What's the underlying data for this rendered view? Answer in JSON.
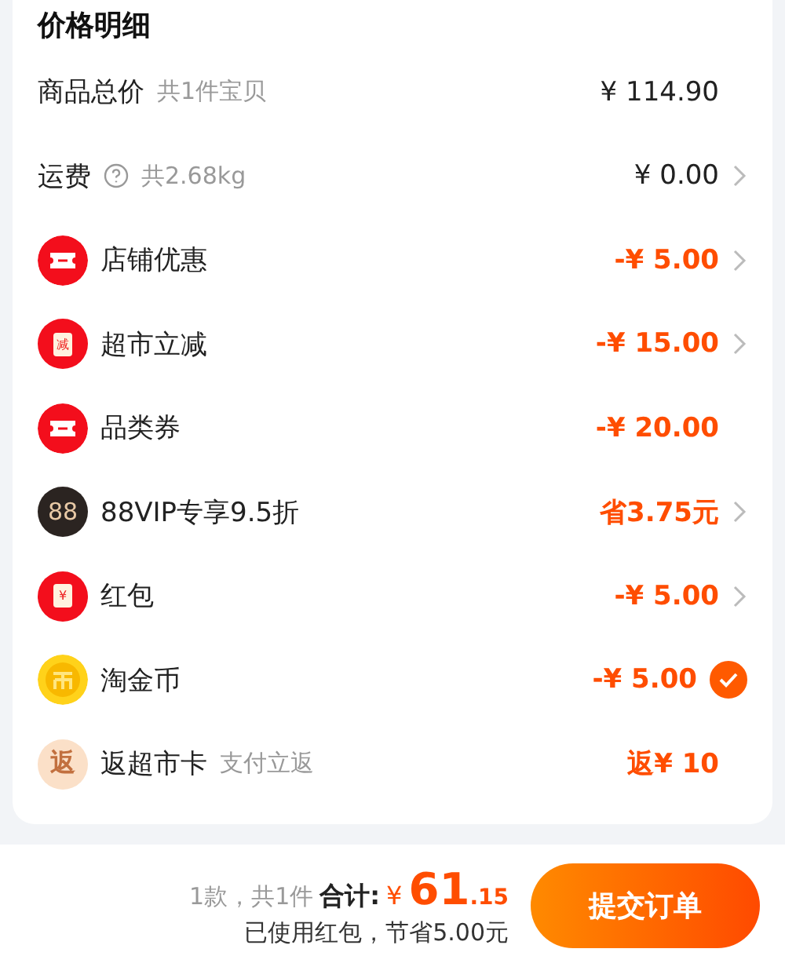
{
  "title": "价格明细",
  "rows": [
    {
      "kind": "plain",
      "label": "商品总价",
      "note": "共1件宝贝",
      "value": "¥ 114.90",
      "discount": false,
      "chevron": false
    },
    {
      "kind": "plain",
      "help": true,
      "label": "运费",
      "note": "共2.68kg",
      "value": "¥ 0.00",
      "discount": false,
      "chevron": true
    },
    {
      "kind": "ticket",
      "label": "店铺优惠",
      "value": "-¥ 5.00",
      "discount": true,
      "chevron": true
    },
    {
      "kind": "reduce",
      "badge": "减",
      "label": "超市立减",
      "value": "-¥ 15.00",
      "discount": true,
      "chevron": true
    },
    {
      "kind": "ticket",
      "label": "品类券",
      "value": "-¥ 20.00",
      "discount": true,
      "chevron": false
    },
    {
      "kind": "vip",
      "badge": "88",
      "label": "88VIP专享9.5折",
      "value": "省3.75元",
      "discount": true,
      "chevron": true
    },
    {
      "kind": "packet",
      "badge": "¥",
      "label": "红包",
      "value": "-¥ 5.00",
      "discount": true,
      "chevron": true
    },
    {
      "kind": "coin",
      "label": "淘金币",
      "value": "-¥ 5.00",
      "discount": true,
      "chevron": false,
      "checked": true
    },
    {
      "kind": "rebate",
      "badge": "返",
      "label": "返超市卡",
      "note": "支付立返",
      "value": "返¥ 10",
      "discount": true,
      "chevron": false
    }
  ],
  "footer": {
    "count": "1款，共1件",
    "total_label": "合计:",
    "currency": "¥",
    "total_int": "61",
    "total_dec": ".15",
    "saving": "已使用红包，节省5.00元",
    "submit": "提交订单"
  }
}
